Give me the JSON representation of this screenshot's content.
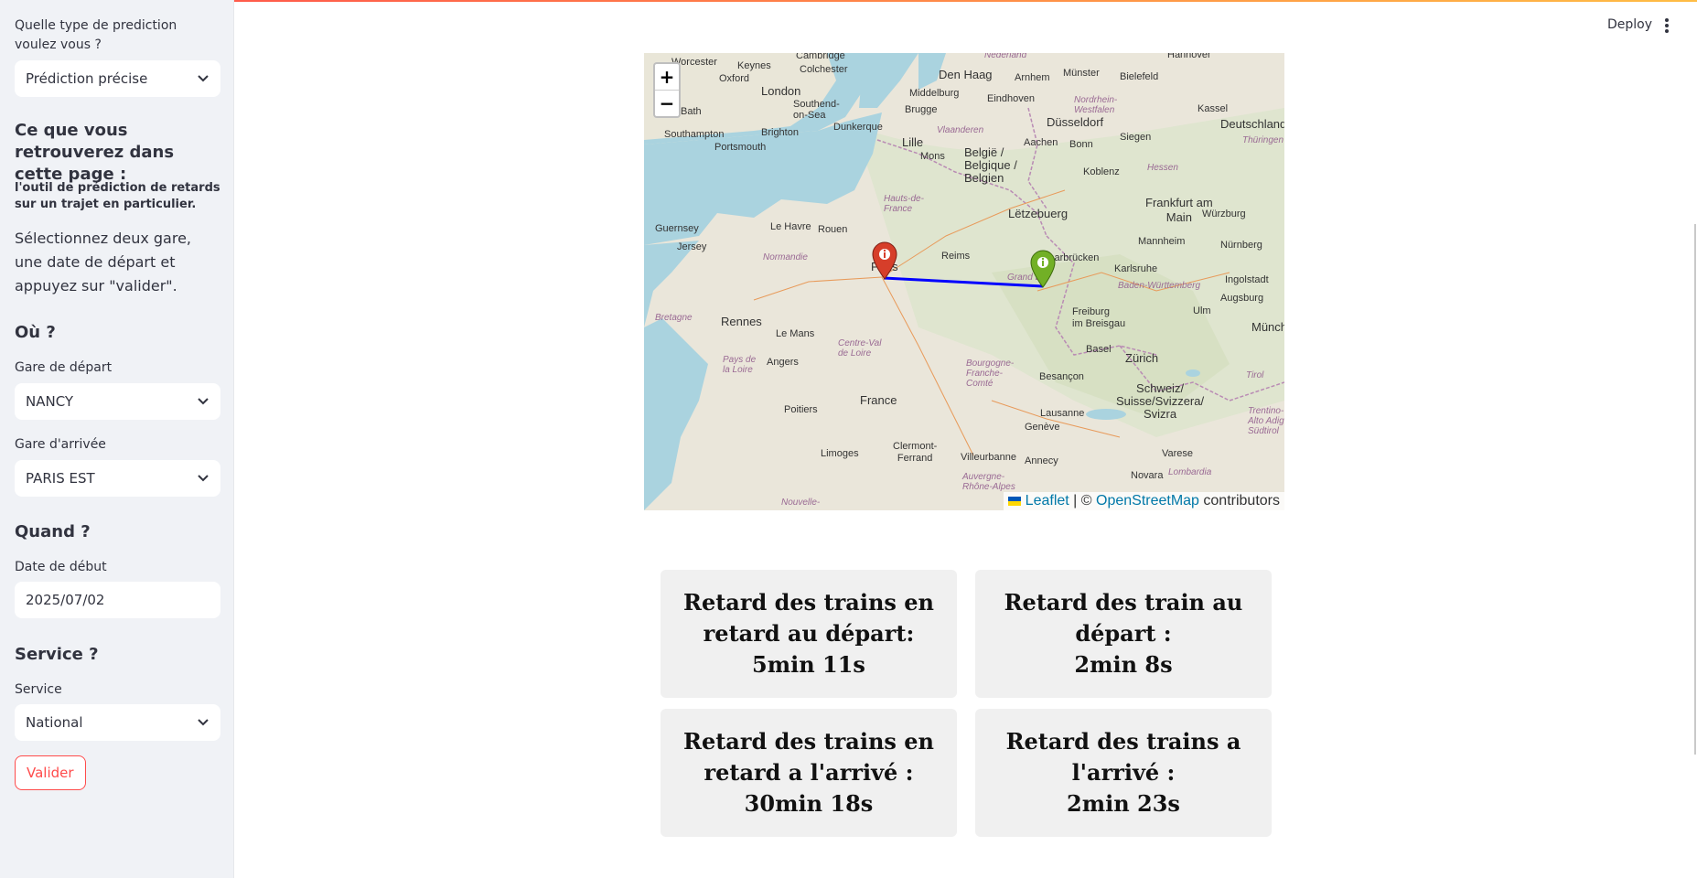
{
  "sidebar": {
    "prediction_type_label": "Quelle type de prediction voulez vous ?",
    "prediction_type_value": "Prédiction précise",
    "page_heading": "Ce que vous retrouverez dans cette page :",
    "tool_description": "l'outil de prédiction de retards sur un trajet en particulier.",
    "instructions": "Sélectionnez deux gare, une date de départ et appuyez sur \"valider\".",
    "where_heading": "Où ?",
    "departure_label": "Gare de départ",
    "departure_value": "NANCY",
    "arrival_label": "Gare d'arrivée",
    "arrival_value": "PARIS EST",
    "when_heading": "Quand ?",
    "start_date_label": "Date de début",
    "start_date_value": "2025/07/02",
    "service_heading": "Service ?",
    "service_label": "Service",
    "service_value": "National",
    "submit_label": "Valider"
  },
  "header": {
    "deploy_label": "Deploy"
  },
  "map": {
    "zoom_in": "+",
    "zoom_out": "−",
    "attribution": {
      "leaflet": "Leaflet",
      "sep": " | © ",
      "osm": "OpenStreetMap",
      "suffix": " contributors"
    },
    "route_color": "#0000ff",
    "departure_marker_color": "#72b026",
    "arrival_marker_color": "#d63e2a",
    "labels": {
      "cambridge": "Cambridge",
      "worcester": "Worcester",
      "colchester": "Colchester",
      "keynes": "Keynes",
      "oxford": "Oxford",
      "london": "London",
      "southend": "Southend-\non-Sea",
      "bath": "Bath",
      "southampton": "Southampton",
      "brighton": "Brighton",
      "portsmouth": "Portsmouth",
      "dunkerque": "Dunkerque",
      "brugge": "Brugge",
      "lille": "Lille",
      "mons": "Mons",
      "middelburg": "Middelburg",
      "den_haag": "Den Haag",
      "nederland": "Nederland",
      "arnhem": "Arnhem",
      "munster": "Münster",
      "bielefeld": "Bielefeld",
      "hannover": "Hannover",
      "eindhoven": "Eindhoven",
      "dusseldorf": "Düsseldorf",
      "vlaanderen": "Vlaanderen",
      "belgique": "België /\nBelgique /\nBelgien",
      "aachen": "Aachen",
      "bonn": "Bonn",
      "siegen": "Siegen",
      "kassel": "Kassel",
      "deutschland": "Deutschland",
      "nordrhein": "Nordrhein-\nWestfalen",
      "hessen": "Hessen",
      "thuringen": "Thüringen",
      "koblenz": "Koblenz",
      "frankfurt": "Frankfurt am\nMain",
      "wurzburg": "Würzburg",
      "letzebuerg": "Lëtzebuerg",
      "guernsey": "Guernsey",
      "le_havre": "Le Havre",
      "rouen": "Rouen",
      "hauts_de_france": "Hauts-de-\nFrance",
      "jersey": "Jersey",
      "normandie": "Normandie",
      "reims": "Reims",
      "paris": "Paris",
      "saarbrucken": "Saarbrücken",
      "mannheim": "Mannheim",
      "nurnberg": "Nürnberg",
      "karlsruhe": "Karlsruhe",
      "grand_est": "Grand Est",
      "ingolstadt": "Ingolstadt",
      "baden_wurttemberg": "Baden-Württemberg",
      "augsburg": "Augsburg",
      "bretagne": "Bretagne",
      "rennes": "Rennes",
      "freiburg": "Freiburg\nim Breisgau",
      "ulm": "Ulm",
      "munchen": "Münche",
      "le_mans": "Le Mans",
      "centre_val_de_loire": "Centre-Val\nde Loire",
      "basel": "Basel",
      "zurich": "Zürich",
      "angers": "Angers",
      "pays_de_la_loire": "Pays de\nla Loire",
      "bourgogne": "Bourgogne-\nFranche-\nComté",
      "besancon": "Besançon",
      "schweiz": "Schweiz/\nSuisse/Svizzera/\nSvizra",
      "tirol": "Tirol",
      "poitiers": "Poitiers",
      "france": "France",
      "lausanne": "Lausanne",
      "trentino": "Trentino-\nAlto Adige/\nSüdtirol",
      "geneve": "Genève",
      "clermont": "Clermont-\nFerrand",
      "limoges": "Limoges",
      "villeurbanne": "Villeurbanne",
      "annecy": "Annecy",
      "varese": "Varese",
      "auvergne": "Auvergne-\nRhône-Alpes",
      "lombardia": "Lombardia",
      "novara": "Novara",
      "nouvelle": "Nouvelle-"
    }
  },
  "cards": [
    {
      "line1": "Retard des trains en",
      "line2": "retard au départ:",
      "line3": "5min 11s"
    },
    {
      "line1": "Retard des train au",
      "line2": "départ :",
      "line3": "2min 8s"
    },
    {
      "line1": "Retard des trains en",
      "line2": "retard a l'arrivé :",
      "line3": "30min 18s"
    },
    {
      "line1": "Retard des trains a",
      "line2": "l'arrivé :",
      "line3": "2min 23s"
    }
  ]
}
